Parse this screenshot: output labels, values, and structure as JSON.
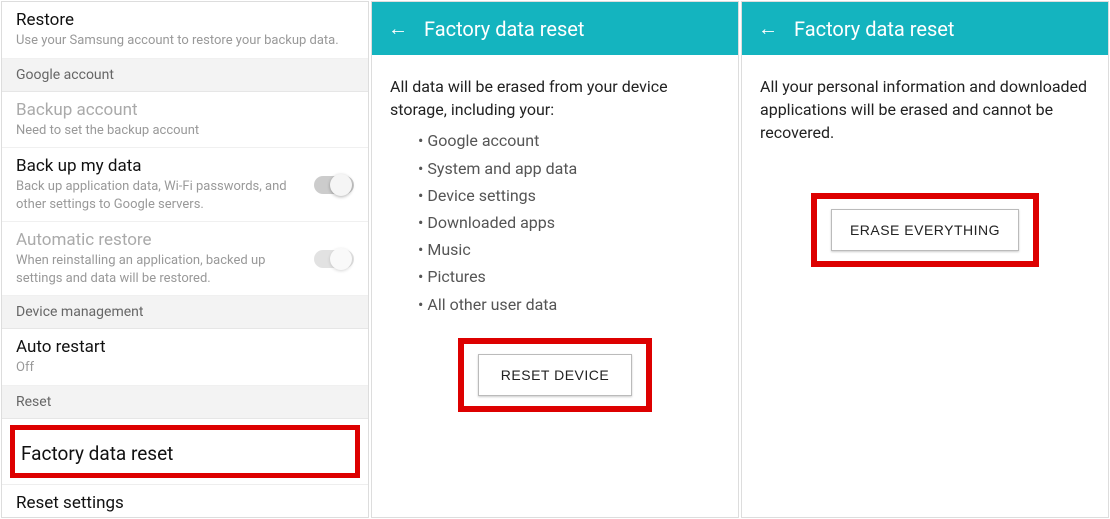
{
  "panel1": {
    "restore": {
      "title": "Restore",
      "sub": "Use your Samsung account to restore your backup data."
    },
    "sec_google": "Google account",
    "backup_account": {
      "title": "Backup account",
      "sub": "Need to set the backup account"
    },
    "backup_data": {
      "title": "Back up my data",
      "sub": "Back up application data, Wi-Fi passwords, and other settings to Google servers."
    },
    "auto_restore": {
      "title": "Automatic restore",
      "sub": "When reinstalling an application, backed up settings and data will be restored."
    },
    "sec_device": "Device management",
    "auto_restart": {
      "title": "Auto restart",
      "sub": "Off"
    },
    "sec_reset": "Reset",
    "factory_reset": "Factory data reset",
    "reset_settings": "Reset settings"
  },
  "panel2": {
    "header": "Factory data reset",
    "intro": "All data will be erased from your device storage, including your:",
    "bullets": [
      "Google account",
      "System and app data",
      "Device settings",
      "Downloaded apps",
      "Music",
      "Pictures",
      "All other user data"
    ],
    "button": "RESET DEVICE"
  },
  "panel3": {
    "header": "Factory data reset",
    "text": "All your personal information and downloaded applications will be erased and cannot be recovered.",
    "button": "ERASE EVERYTHING"
  }
}
